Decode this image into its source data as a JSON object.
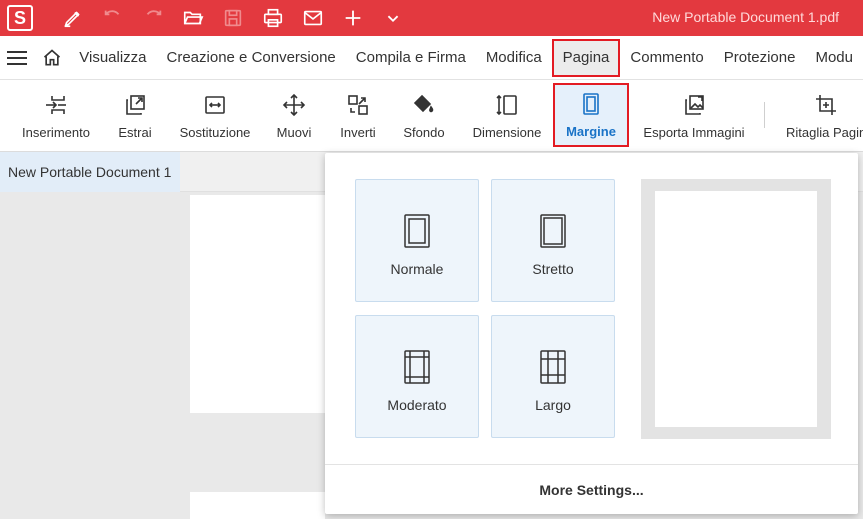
{
  "app": {
    "logo_letter": "S",
    "document_title": "New Portable Document 1.pdf"
  },
  "quick_access": [
    "pen-icon",
    "undo-icon",
    "redo-icon",
    "folder-open-icon",
    "save-icon",
    "print-icon",
    "mail-icon",
    "plus-icon",
    "chevron-down-icon"
  ],
  "menu": {
    "items": [
      {
        "label": "Visualizza"
      },
      {
        "label": "Creazione e Conversione"
      },
      {
        "label": "Compila e Firma"
      },
      {
        "label": "Modifica"
      },
      {
        "label": "Pagina"
      },
      {
        "label": "Commento"
      },
      {
        "label": "Protezione"
      },
      {
        "label": "Modu"
      }
    ]
  },
  "toolbar": {
    "tools": [
      {
        "label": "Inserimento"
      },
      {
        "label": "Estrai"
      },
      {
        "label": "Sostituzione"
      },
      {
        "label": "Muovi"
      },
      {
        "label": "Inverti"
      },
      {
        "label": "Sfondo"
      },
      {
        "label": "Dimensione"
      },
      {
        "label": "Margine"
      },
      {
        "label": "Esporta Immagini"
      },
      {
        "label": "Ritaglia Pagina"
      }
    ]
  },
  "document_tab": {
    "label": "New Portable Document 1"
  },
  "margin_menu": {
    "options": [
      {
        "label": "Normale"
      },
      {
        "label": "Stretto"
      },
      {
        "label": "Moderato"
      },
      {
        "label": "Largo"
      }
    ],
    "more_settings": "More Settings..."
  },
  "colors": {
    "brand_red": "#e3393f",
    "highlight_red": "#e31b23",
    "active_blue": "#1a73c7"
  }
}
